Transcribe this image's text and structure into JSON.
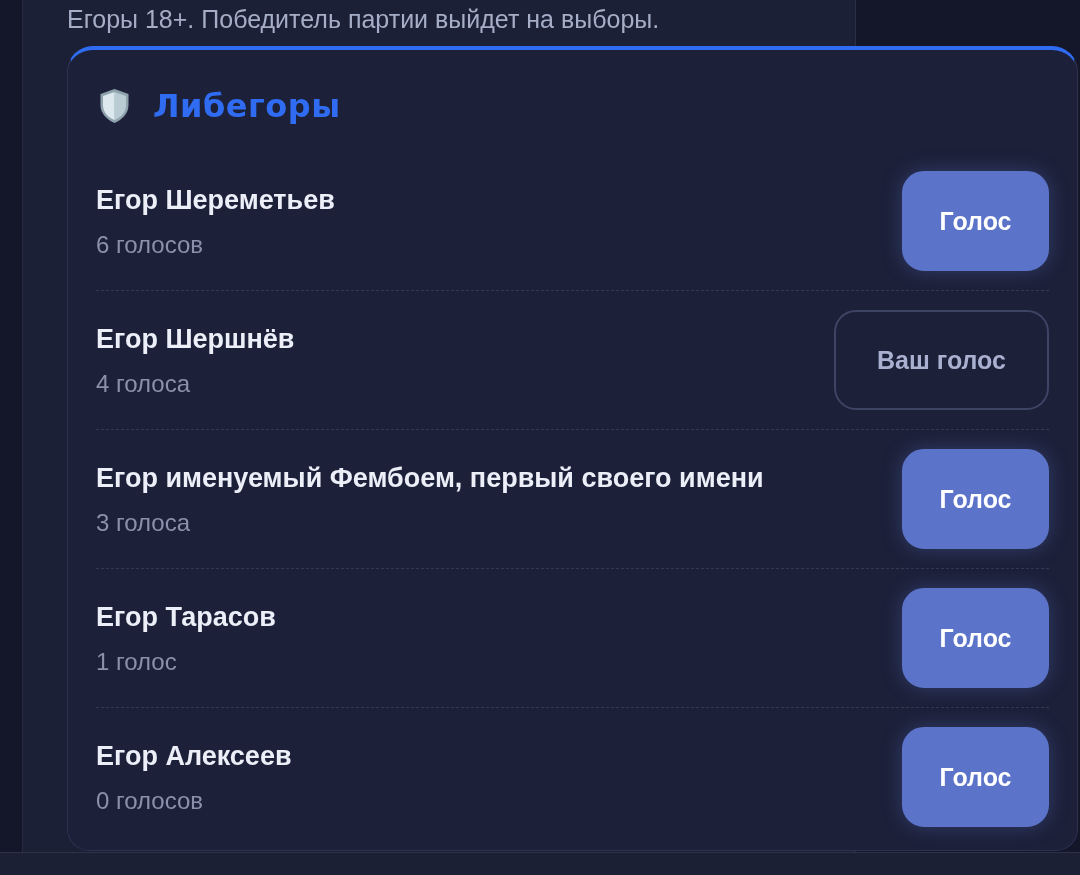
{
  "intro": "Егоры 18+. Победитель партии выйдет на выборы.",
  "party": {
    "title": "Либегоры",
    "candidates": [
      {
        "name": "Егор Шереметьев",
        "votes": "6 голосов",
        "button": "Голос",
        "selected": false
      },
      {
        "name": "Егор Шершнёв",
        "votes": "4 голоса",
        "button": "Ваш голос",
        "selected": true
      },
      {
        "name": "Егор именуемый Фембоем, первый своего имени",
        "votes": "3 голоса",
        "button": "Голос",
        "selected": false
      },
      {
        "name": "Егор Тарасов",
        "votes": "1 голос",
        "button": "Голос",
        "selected": false
      },
      {
        "name": "Егор Алексеев",
        "votes": "0 голосов",
        "button": "Голос",
        "selected": false
      }
    ]
  }
}
